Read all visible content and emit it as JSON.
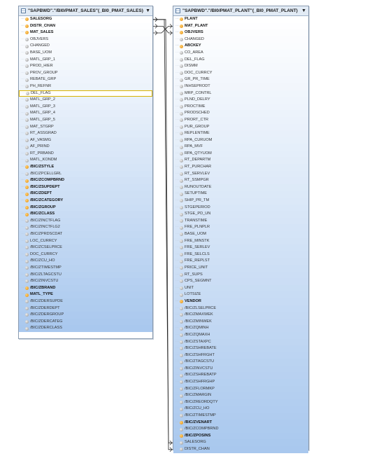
{
  "table1": {
    "title": "\"SAPBWD\".\"/BI0/PMAT_SALES\"(_BI0_PMAT_SALES)",
    "dropdown_icon": "chevron-down-icon",
    "fields": [
      {
        "name": "SALESORG",
        "key": true,
        "bold": true
      },
      {
        "name": "DISTR_CHAN",
        "key": true,
        "bold": true
      },
      {
        "name": "MAT_SALES",
        "key": true,
        "bold": true
      },
      {
        "name": "OBJVERS",
        "key": false,
        "bold": false
      },
      {
        "name": "CHANGED",
        "key": false,
        "bold": false
      },
      {
        "name": "BASE_UOM",
        "key": false,
        "bold": false
      },
      {
        "name": "MATL_GRP_1",
        "key": false,
        "bold": false
      },
      {
        "name": "PROD_HIER",
        "key": false,
        "bold": false
      },
      {
        "name": "PROV_GROUP",
        "key": false,
        "bold": false
      },
      {
        "name": "REBATE_GRP",
        "key": false,
        "bold": false
      },
      {
        "name": "PH_REFNR",
        "key": false,
        "bold": false
      },
      {
        "name": "DEL_FLAG",
        "key": false,
        "bold": false,
        "highlight": true
      },
      {
        "name": "MATL_GRP_2",
        "key": false,
        "bold": false
      },
      {
        "name": "MATL_GRP_3",
        "key": false,
        "bold": false
      },
      {
        "name": "MATL_GRP_4",
        "key": false,
        "bold": false
      },
      {
        "name": "MATL_GRP_5",
        "key": false,
        "bold": false
      },
      {
        "name": "MAT_STGRP",
        "key": false,
        "bold": false
      },
      {
        "name": "RT_ASSGRAD",
        "key": false,
        "bold": false
      },
      {
        "name": "AF_VASMG",
        "key": false,
        "bold": false
      },
      {
        "name": "AF_PRIND",
        "key": false,
        "bold": false
      },
      {
        "name": "RT_PRBAND",
        "key": false,
        "bold": false
      },
      {
        "name": "MATL_KONDM",
        "key": false,
        "bold": false
      },
      {
        "name": "/BIC/ZSTYLE",
        "key": true,
        "bold": true
      },
      {
        "name": "/BIC/ZPCELLGRL",
        "key": false,
        "bold": false
      },
      {
        "name": "/BIC/ZCOMPBRND",
        "key": true,
        "bold": true
      },
      {
        "name": "/BIC/ZSUPDEPT",
        "key": true,
        "bold": true
      },
      {
        "name": "/BIC/ZDEPT",
        "key": true,
        "bold": true
      },
      {
        "name": "/BIC/ZCATEGORY",
        "key": true,
        "bold": true
      },
      {
        "name": "/BIC/ZGROUP",
        "key": true,
        "bold": true
      },
      {
        "name": "/BIC/ZCLASS",
        "key": true,
        "bold": true
      },
      {
        "name": "/BIC/ZINCTFLAG",
        "key": false,
        "bold": false
      },
      {
        "name": "/BIC/ZINCTFLG2",
        "key": false,
        "bold": false
      },
      {
        "name": "/BIC/ZPRDSCDAT",
        "key": false,
        "bold": false
      },
      {
        "name": "LOC_CURRCY",
        "key": false,
        "bold": false
      },
      {
        "name": "/BIC/ZCSELPRCE",
        "key": false,
        "bold": false
      },
      {
        "name": "DOC_CURRCY",
        "key": false,
        "bold": false
      },
      {
        "name": "/BIC/ZCU_HO",
        "key": false,
        "bold": false
      },
      {
        "name": "/BIC/ZTIMESTMP",
        "key": false,
        "bold": false
      },
      {
        "name": "/BIC/ZLTAGCSTU",
        "key": false,
        "bold": false
      },
      {
        "name": "/BIC/ZINVCSTU",
        "key": false,
        "bold": false
      },
      {
        "name": "/BIC/ZBRAND",
        "key": true,
        "bold": true
      },
      {
        "name": "MATL_TYPE",
        "key": true,
        "bold": true
      },
      {
        "name": "/BIC/ZDERSUPDE",
        "key": false,
        "bold": false
      },
      {
        "name": "/BIC/ZDERDEPT",
        "key": false,
        "bold": false
      },
      {
        "name": "/BIC/ZDERGROUP",
        "key": false,
        "bold": false
      },
      {
        "name": "/BIC/ZDERCATEG",
        "key": false,
        "bold": false
      },
      {
        "name": "/BIC/ZDERCLASS",
        "key": false,
        "bold": false
      }
    ]
  },
  "table2": {
    "title": "\"SAPBWD\".\"/BI0/PMAT_PLANT\"(_BI0_PMAT_PLANT)",
    "dropdown_icon": "chevron-down-icon",
    "fields": [
      {
        "name": "PLANT",
        "key": true,
        "bold": true
      },
      {
        "name": "MAT_PLANT",
        "key": true,
        "bold": true
      },
      {
        "name": "OBJVERS",
        "key": true,
        "bold": true
      },
      {
        "name": "CHANGED",
        "key": false,
        "bold": false
      },
      {
        "name": "ABCKEY",
        "key": true,
        "bold": true
      },
      {
        "name": "CO_AREA",
        "key": false,
        "bold": false
      },
      {
        "name": "DEL_FLAG",
        "key": false,
        "bold": false
      },
      {
        "name": "DISMM",
        "key": false,
        "bold": false
      },
      {
        "name": "DOC_CURRCY",
        "key": false,
        "bold": false
      },
      {
        "name": "GR_PR_TIME",
        "key": false,
        "bold": false
      },
      {
        "name": "INHSEPRODT",
        "key": false,
        "bold": false
      },
      {
        "name": "MRP_CONTRL",
        "key": false,
        "bold": false
      },
      {
        "name": "PLND_DELRY",
        "key": false,
        "bold": false
      },
      {
        "name": "PROCTIME",
        "key": false,
        "bold": false
      },
      {
        "name": "PRODSCHED",
        "key": false,
        "bold": false
      },
      {
        "name": "PRORT_CTR",
        "key": false,
        "bold": false
      },
      {
        "name": "PUR_GROUP",
        "key": false,
        "bold": false
      },
      {
        "name": "REPLENTIME",
        "key": false,
        "bold": false
      },
      {
        "name": "RPA_CURUOM",
        "key": false,
        "bold": false
      },
      {
        "name": "RPA_MVF",
        "key": false,
        "bold": false
      },
      {
        "name": "RPA_QTYUOM",
        "key": false,
        "bold": false
      },
      {
        "name": "RT_DEPARTM",
        "key": false,
        "bold": false
      },
      {
        "name": "RT_PURCHAR",
        "key": false,
        "bold": false
      },
      {
        "name": "RT_SERVLEV",
        "key": false,
        "bold": false
      },
      {
        "name": "RT_SSMPGR",
        "key": false,
        "bold": false
      },
      {
        "name": "RUNOUTDATE",
        "key": false,
        "bold": false
      },
      {
        "name": "SETUPTIME",
        "key": false,
        "bold": false
      },
      {
        "name": "SHIP_PR_TM",
        "key": false,
        "bold": false
      },
      {
        "name": "STGEPERIOD",
        "key": false,
        "bold": false
      },
      {
        "name": "STGE_PD_UN",
        "key": false,
        "bold": false
      },
      {
        "name": "TRANSTIME",
        "key": false,
        "bold": false
      },
      {
        "name": "FRE_PLNPLR",
        "key": false,
        "bold": false
      },
      {
        "name": "BASE_UOM",
        "key": false,
        "bold": false
      },
      {
        "name": "FRE_MINSTK",
        "key": false,
        "bold": false
      },
      {
        "name": "FRE_SERLEV",
        "key": false,
        "bold": false
      },
      {
        "name": "FRE_SELCLS",
        "key": false,
        "bold": false
      },
      {
        "name": "FRE_REPLST",
        "key": false,
        "bold": false
      },
      {
        "name": "PRICE_UNIT",
        "key": false,
        "bold": false
      },
      {
        "name": "RT_SUPS",
        "key": false,
        "bold": false
      },
      {
        "name": "CPS_SEGMNT",
        "key": false,
        "bold": false
      },
      {
        "name": "UNIT",
        "key": false,
        "bold": false
      },
      {
        "name": "LOTSIZE",
        "key": false,
        "bold": false
      },
      {
        "name": "VENDOR",
        "key": true,
        "bold": true
      },
      {
        "name": "/BIC/ZLSELPRCE",
        "key": false,
        "bold": false
      },
      {
        "name": "/BIC/ZMAXWEK",
        "key": false,
        "bold": false
      },
      {
        "name": "/BIC/ZMINWEK",
        "key": false,
        "bold": false
      },
      {
        "name": "/BIC/ZQMINH",
        "key": false,
        "bold": false
      },
      {
        "name": "/BIC/ZQMAXH",
        "key": false,
        "bold": false
      },
      {
        "name": "/BIC/ZSTAXPC",
        "key": false,
        "bold": false
      },
      {
        "name": "/BIC/ZSHREBATE",
        "key": false,
        "bold": false
      },
      {
        "name": "/BIC/ZSHFRGHT",
        "key": false,
        "bold": false
      },
      {
        "name": "/BIC/ZTAGCSTU",
        "key": false,
        "bold": false
      },
      {
        "name": "/BIC/ZINVCSTU",
        "key": false,
        "bold": false
      },
      {
        "name": "/BIC/ZSHREBATP",
        "key": false,
        "bold": false
      },
      {
        "name": "/BIC/ZSHFRGHP",
        "key": false,
        "bold": false
      },
      {
        "name": "/BIC/ZFLORMKP",
        "key": false,
        "bold": false
      },
      {
        "name": "/BIC/ZMARGIN",
        "key": false,
        "bold": false
      },
      {
        "name": "/BIC/ZREORDQTY",
        "key": false,
        "bold": false
      },
      {
        "name": "/BIC/ZCU_HO",
        "key": false,
        "bold": false
      },
      {
        "name": "/BIC/ZTIMESTMP",
        "key": false,
        "bold": false
      },
      {
        "name": "/BIC/ZVENART",
        "key": true,
        "bold": true
      },
      {
        "name": "/BIC/ZCOMPBRND",
        "key": false,
        "bold": false
      },
      {
        "name": "/BIC/ZPOSINS",
        "key": true,
        "bold": true
      },
      {
        "name": "SALESORG",
        "key": false,
        "bold": false
      },
      {
        "name": "DISTR_CHAN",
        "key": false,
        "bold": false
      }
    ]
  },
  "links": [
    {
      "from_table": "table1",
      "from_field": "MAT_SALES",
      "to_table": "table2",
      "to_field": "MAT_PLANT"
    },
    {
      "from_table": "table1",
      "from_field": "DISTR_CHAN",
      "to_table": "table2",
      "to_field": "OBJVERS"
    },
    {
      "from_table": "table1",
      "from_field": "SALESORG",
      "to_table": "table2",
      "to_field": "SALESORG"
    },
    {
      "from_table": "table1",
      "from_field": "SALESORG",
      "to_table": "table2",
      "to_field": "DISTR_CHAN"
    }
  ],
  "colors": {
    "header_bg": "#e2ebf5",
    "border": "#8a9bb0",
    "key_dot": "#e58a00",
    "gradient_top": "#ffffff",
    "gradient_bottom": "#a9c8ee",
    "highlight_border": "#d8b200",
    "link_line": "#222222"
  }
}
